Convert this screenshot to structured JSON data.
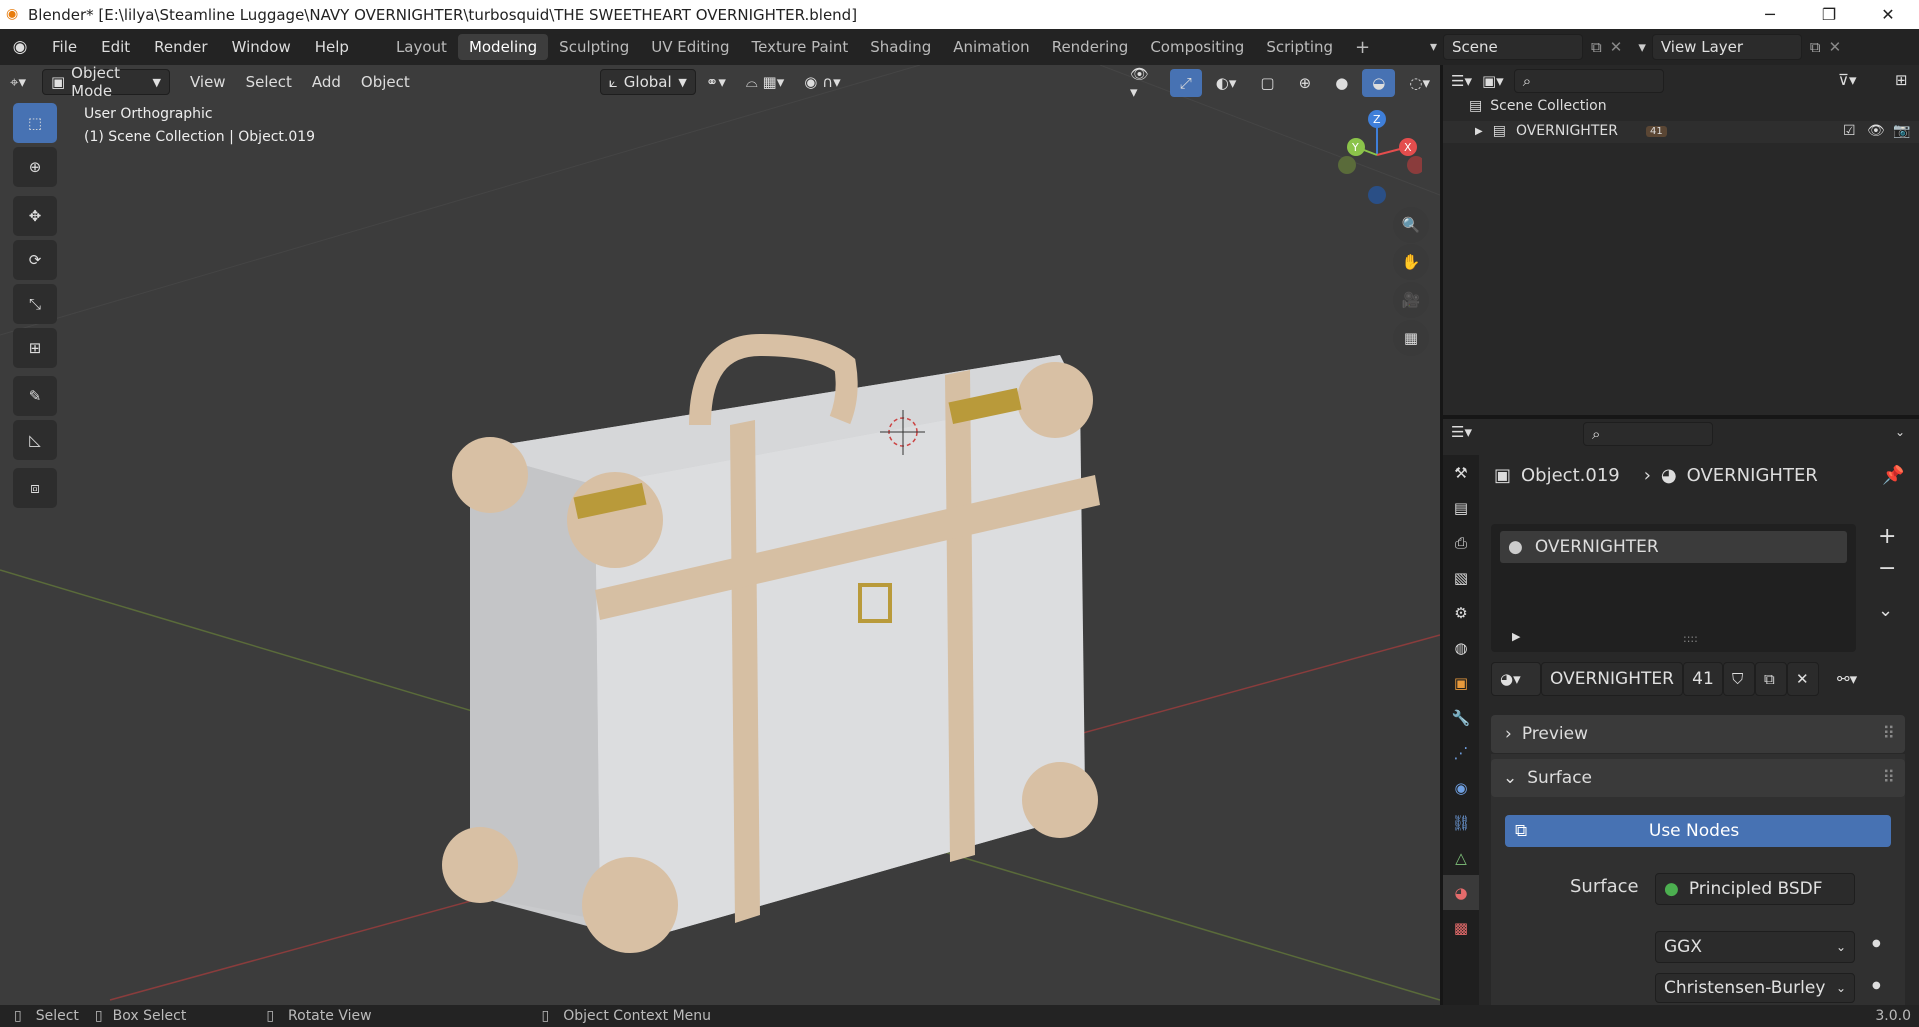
{
  "window": {
    "title": "Blender* [E:\\lilya\\Steamline Luggage\\NAVY OVERNIGHTER\\turbosquid\\THE SWEETHEART OVERNIGHTER.blend]",
    "minimize": "─",
    "maximize": "❐",
    "close": "✕"
  },
  "menu": [
    "File",
    "Edit",
    "Render",
    "Window",
    "Help"
  ],
  "workspaces": [
    "Layout",
    "Modeling",
    "Sculpting",
    "UV Editing",
    "Texture Paint",
    "Shading",
    "Animation",
    "Rendering",
    "Compositing",
    "Scripting"
  ],
  "active_workspace": "Modeling",
  "add_workspace": "+",
  "scene": {
    "value": "Scene"
  },
  "view_layer": {
    "value": "View Layer"
  },
  "viewport_header": {
    "mode": "Object Mode",
    "menus": [
      "View",
      "Select",
      "Add",
      "Object"
    ],
    "orientation": "Global"
  },
  "viewport": {
    "view_name": "User Orthographic",
    "collection_info": "(1) Scene Collection | Object.019",
    "gizmo": {
      "z": "Z",
      "y": "Y",
      "x": "X"
    }
  },
  "outliner": {
    "scene_collection": "Scene Collection",
    "item": "OVERNIGHTER",
    "badge_count": "41"
  },
  "properties": {
    "breadcrumb_object": "Object.019",
    "breadcrumb_material": "OVERNIGHTER",
    "slot_name": "OVERNIGHTER",
    "material_name": "OVERNIGHTER",
    "user_count": "41",
    "preview_label": "Preview",
    "surface_label": "Surface",
    "use_nodes": "Use Nodes",
    "surface_field_label": "Surface",
    "surface_shader": "Principled BSDF",
    "distribution": "GGX",
    "subsurface_method": "Christensen-Burley",
    "slot_add": "+",
    "slot_remove": "−",
    "slot_menu": "⌄"
  },
  "statusbar": {
    "select": "Select",
    "box_select": "Box Select",
    "rotate_view": "Rotate View",
    "context_menu": "Object Context Menu",
    "version": "3.0.0"
  },
  "colors": {
    "accent": "#4772b3",
    "axis_x": "#e44d4d",
    "axis_y": "#8bc34a",
    "axis_z": "#3f7fd9",
    "suitcase_body": "#d9dadb",
    "suitcase_trim": "#d8c0a4",
    "brass": "#b99a3a"
  }
}
